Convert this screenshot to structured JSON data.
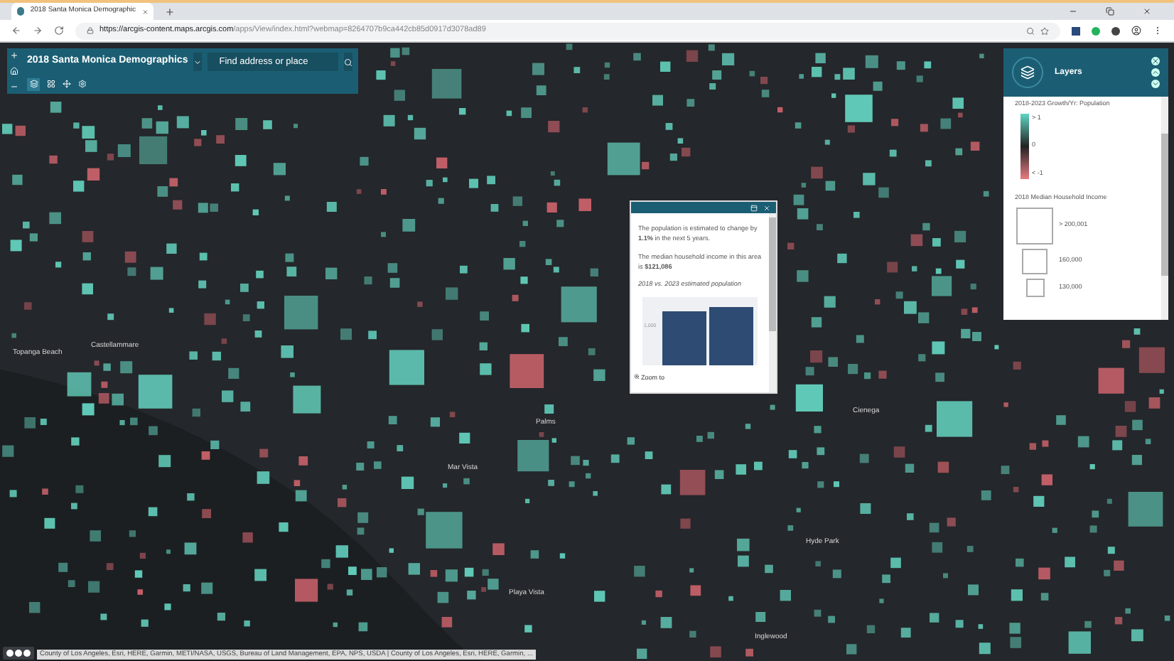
{
  "browser": {
    "tab_title": "2018 Santa Monica Demographic",
    "url_host": "https://arcgis-content.maps.arcgis.com",
    "url_path": "/apps/View/index.html?webmap=8264707b9ca442cb85d0917d3078ad89"
  },
  "app_bar": {
    "title": "2018 Santa Monica Demographics",
    "search": {
      "placeholder": "Find address or place"
    }
  },
  "map_labels": [
    "Topanga Beach",
    "Castellammare",
    "Playa Vista",
    "Inglewood",
    "Mar Vista",
    "Palms",
    "Hyde Park",
    "Cienega"
  ],
  "layers_panel": {
    "title": "Layers",
    "growth_title": "2018-2023 Growth/Yr: Population",
    "growth_stops": [
      "> 1",
      "0",
      "< -1"
    ],
    "income_title": "2018 Median Household Income",
    "income_stops": [
      "> 200,001",
      "160,000",
      "130,000"
    ]
  },
  "popup": {
    "paragraphs": [
      "The population is estimated to change by **1.1%** in the next 5 years.",
      "The median household income in this area is **$121,086**"
    ],
    "chart_title": "2018 vs. 2023 estimated population",
    "axis_label": "1,000",
    "zoom_link": "Zoom to"
  },
  "attribution": "County of Los Angeles, Esri, HERE, Garmin, METI/NASA, USGS, Bureau of Land Management, EPA, NPS, USDA | County of Los Angeles, Esri, HERE, Garmin, ..."
}
